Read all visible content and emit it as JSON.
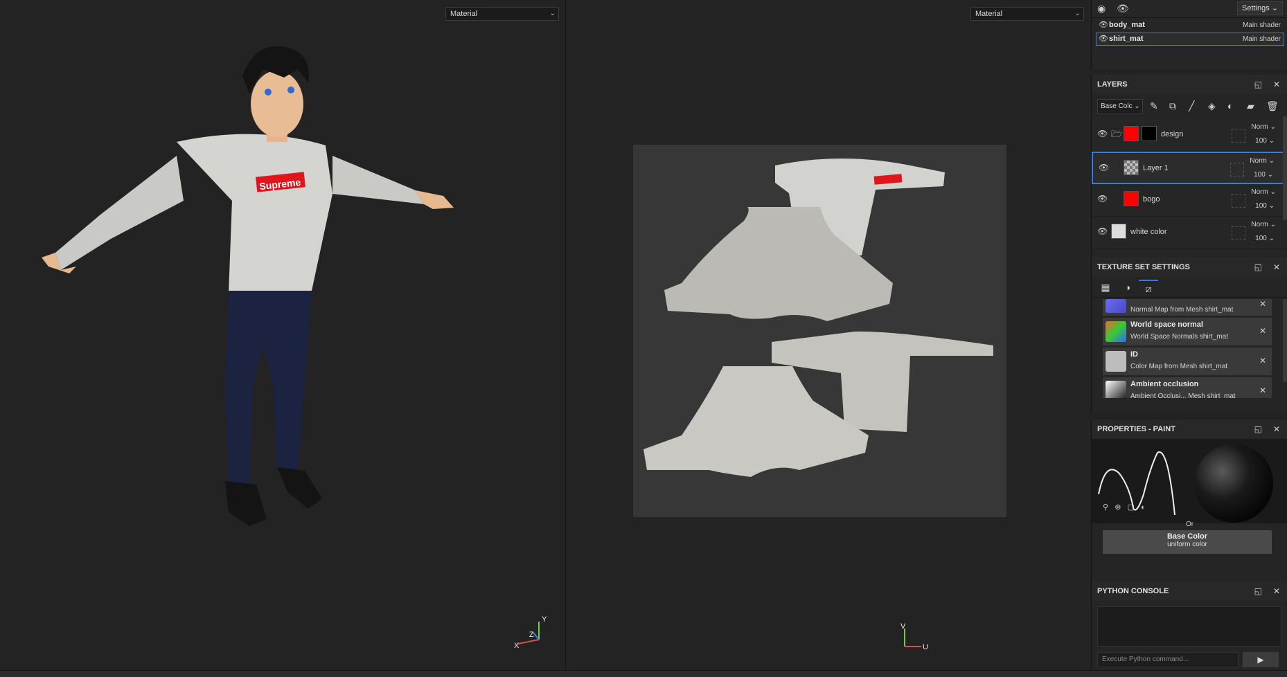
{
  "viewport3d": {
    "material_select": "Material",
    "gizmo_axes": [
      "Y",
      "Z",
      "X"
    ]
  },
  "viewport2d": {
    "material_select": "Material",
    "gizmo_axes": [
      "V",
      "U"
    ],
    "logo_text": "Supreme"
  },
  "texture_sets": {
    "settings_label": "Settings",
    "items": [
      {
        "name": "body_mat",
        "shader": "Main shader",
        "selected": false
      },
      {
        "name": "shirt_mat",
        "shader": "Main shader",
        "selected": true
      }
    ]
  },
  "layers": {
    "title": "LAYERS",
    "channel_select": "Base Colc",
    "rows": [
      {
        "name": "design",
        "blend": "Norm",
        "opacity": "100",
        "thumb_color": "#ff0000",
        "mask_color": "#000000",
        "is_folder": true
      },
      {
        "name": "Layer 1",
        "blend": "Norm",
        "opacity": "100",
        "thumb_color": "#888888",
        "selected": true
      },
      {
        "name": "bogo",
        "blend": "Norm",
        "opacity": "100",
        "thumb_color": "#ff0000"
      },
      {
        "name": "white color",
        "blend": "Norm",
        "opacity": "100",
        "thumb_color": "#dddddd"
      }
    ]
  },
  "texture_set_settings": {
    "title": "TEXTURE SET SETTINGS",
    "bakes": [
      {
        "title": "",
        "sub": "Normal Map from Mesh shirt_mat"
      },
      {
        "title": "World space normal",
        "sub": "World Space Normals shirt_mat"
      },
      {
        "title": "ID",
        "sub": "Color Map from Mesh shirt_mat"
      },
      {
        "title": "Ambient occlusion",
        "sub": "Ambient Occlusi... Mesh shirt_mat"
      }
    ]
  },
  "properties": {
    "title": "PROPERTIES - PAINT",
    "or_label": "Or",
    "base_color_title": "Base Color",
    "base_color_sub": "uniform color"
  },
  "python_console": {
    "title": "PYTHON CONSOLE",
    "placeholder": "Execute Python command..."
  }
}
